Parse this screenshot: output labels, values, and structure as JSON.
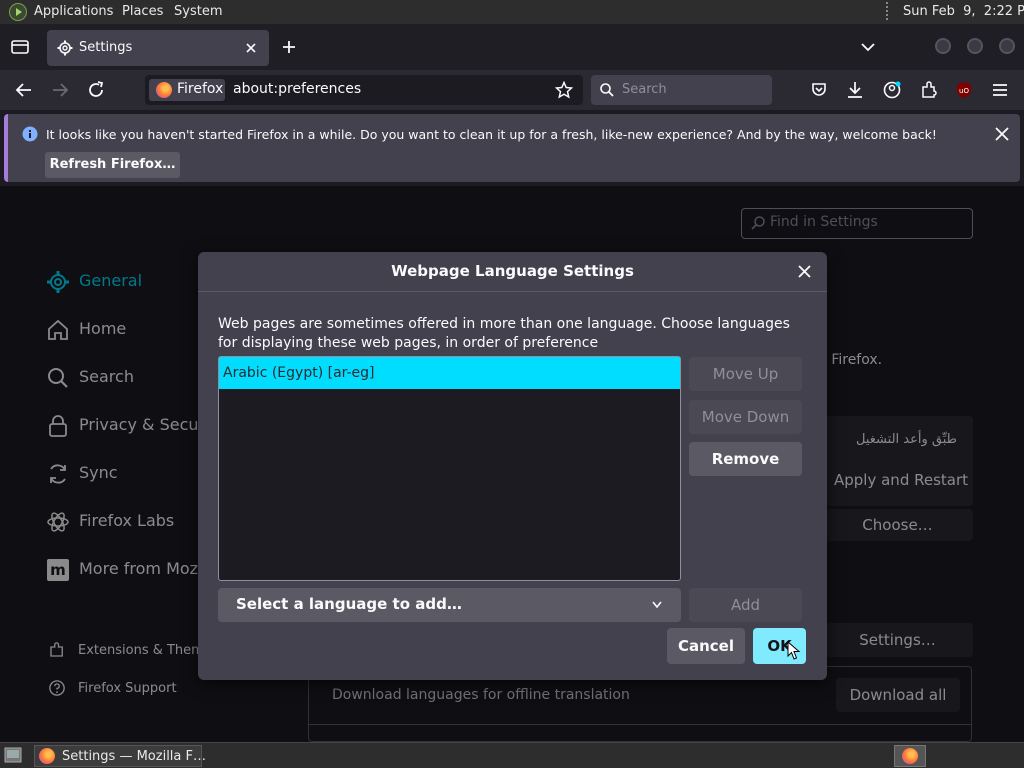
{
  "panel": {
    "menus": [
      "Applications",
      "Places",
      "System"
    ],
    "clock": "Sun Feb  9,  2:22 PM"
  },
  "tabs": [
    {
      "title": "Settings"
    }
  ],
  "toolbar": {
    "identity_label": "Firefox",
    "url": "about:preferences",
    "search_placeholder": "Search"
  },
  "notification": {
    "message": "It looks like you haven't started Firefox in a while. Do you want to clean it up for a fresh, like-new experience? And by the way, welcome back!",
    "button": "Refresh Firefox…"
  },
  "settings": {
    "find_placeholder": "Find in Settings",
    "nav": [
      {
        "label": "General",
        "icon": "gear-icon",
        "selected": true
      },
      {
        "label": "Home",
        "icon": "home-icon"
      },
      {
        "label": "Search",
        "icon": "search-icon"
      },
      {
        "label": "Privacy & Security",
        "icon": "lock-icon"
      },
      {
        "label": "Sync",
        "icon": "sync-icon"
      },
      {
        "label": "Firefox Labs",
        "icon": "labs-icon"
      },
      {
        "label": "More from Mozilla",
        "icon": "mozilla-icon"
      }
    ],
    "footer_nav": [
      {
        "label": "Extensions & Themes",
        "icon": "puzzle-icon"
      },
      {
        "label": "Firefox Support",
        "icon": "help-icon"
      }
    ],
    "bg_text_firefox": "n Firefox.",
    "bg_arabic": "طبِّق وأعد التشغيل",
    "apply_restart": "Apply and Restart",
    "choose": "Choose…",
    "settings_btn": "Settings…",
    "download_languages": "Download languages for offline translation",
    "download_all": "Download all"
  },
  "dialog": {
    "title": "Webpage Language Settings",
    "description": "Web pages are sometimes offered in more than one language. Choose languages for displaying these web pages, in order of preference",
    "languages": [
      "Arabic (Egypt) [ar-eg]"
    ],
    "move_up": "Move Up",
    "move_down": "Move Down",
    "remove": "Remove",
    "select_placeholder": "Select a language to add…",
    "add": "Add",
    "cancel": "Cancel",
    "ok": "OK"
  },
  "taskbar": {
    "task_label": "Settings — Mozilla F…"
  },
  "colors": {
    "accent": "#00ddff",
    "ok_button": "#80ebff",
    "dialog_bg": "#42414d",
    "page_bg": "#1c1b22"
  }
}
